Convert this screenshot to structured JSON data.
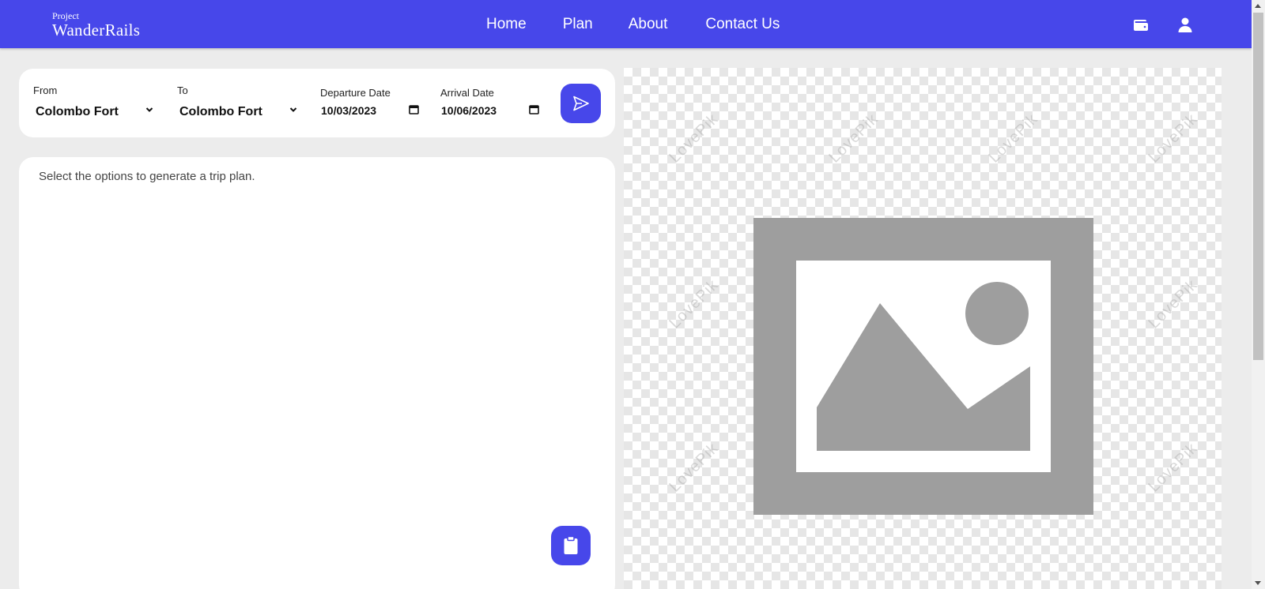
{
  "brand": {
    "small": "Project",
    "big": "WanderRails"
  },
  "nav": {
    "links": [
      {
        "label": "Home"
      },
      {
        "label": "Plan"
      },
      {
        "label": "About"
      },
      {
        "label": "Contact Us"
      }
    ],
    "icons": [
      "wallet-icon",
      "user-icon"
    ]
  },
  "search": {
    "from_label": "From",
    "from_value": "Colombo Fort",
    "to_label": "To",
    "to_value": "Colombo Fort",
    "departure_label": "Departure Date",
    "departure_value": "10/03/2023",
    "arrival_label": "Arrival Date",
    "arrival_value": "10/06/2023",
    "submit_icon": "send-icon"
  },
  "plan": {
    "hint": "Select the options to generate a trip plan.",
    "clipboard_icon": "clipboard-icon"
  },
  "image_panel": {
    "placeholder_icon": "image-placeholder-icon",
    "watermark": "LovePik"
  },
  "colors": {
    "accent": "#4747ea",
    "background": "#ececec",
    "card": "#ffffff",
    "placeholder_gray": "#9e9e9e"
  }
}
